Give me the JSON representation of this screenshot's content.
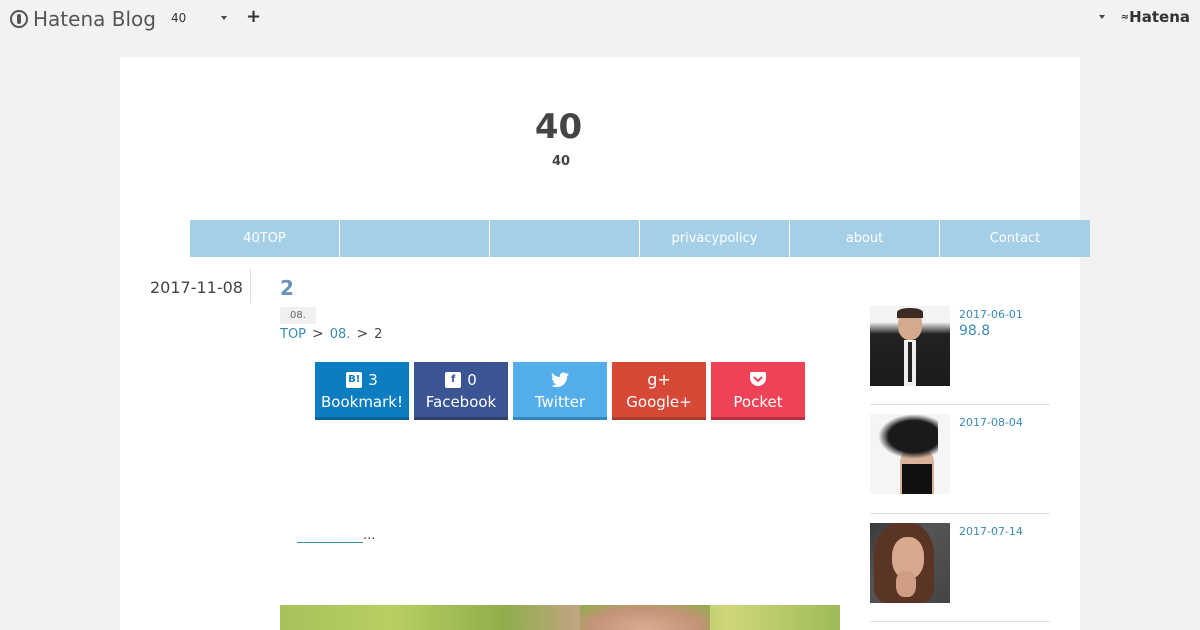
{
  "topbar": {
    "logo_text": "Hatena Blog",
    "blog_select": "40",
    "add_label": "+",
    "brand": "Hatena"
  },
  "blog": {
    "title": "40",
    "description": "40"
  },
  "nav": {
    "items": [
      {
        "label": "40TOP"
      },
      {
        "label": ""
      },
      {
        "label": ""
      },
      {
        "label": "privacypolicy"
      },
      {
        "label": "about"
      },
      {
        "label": "Contact"
      }
    ]
  },
  "entry": {
    "date": "2017-11-08",
    "title": "2",
    "category": "08.",
    "breadcrumb": {
      "home": "TOP",
      "sep1": ">",
      "category": "08.",
      "sep2": ">",
      "current": "2"
    },
    "share": [
      {
        "count": "3",
        "label": "Bookmark!",
        "icon": "hatena-bookmark-icon"
      },
      {
        "count": "0",
        "label": "Facebook",
        "icon": "facebook-icon"
      },
      {
        "label": "Twitter",
        "icon": "twitter-icon"
      },
      {
        "label": "Google+",
        "icon": "google-plus-icon"
      },
      {
        "label": "Pocket",
        "icon": "pocket-icon"
      }
    ],
    "more_suffix": "..."
  },
  "sidebar": {
    "items": [
      {
        "date": "2017-06-01",
        "title": "98.8"
      },
      {
        "date": "2017-08-04",
        "title": ""
      },
      {
        "date": "2017-07-14",
        "title": ""
      }
    ]
  },
  "colors": {
    "nav_bg": "#a4cfe6",
    "link": "#3a8ab7",
    "hatena_blue": "#0d7dc1",
    "facebook": "#3b5493",
    "twitter": "#54aee9",
    "google": "#d64937",
    "pocket": "#ee4256"
  }
}
